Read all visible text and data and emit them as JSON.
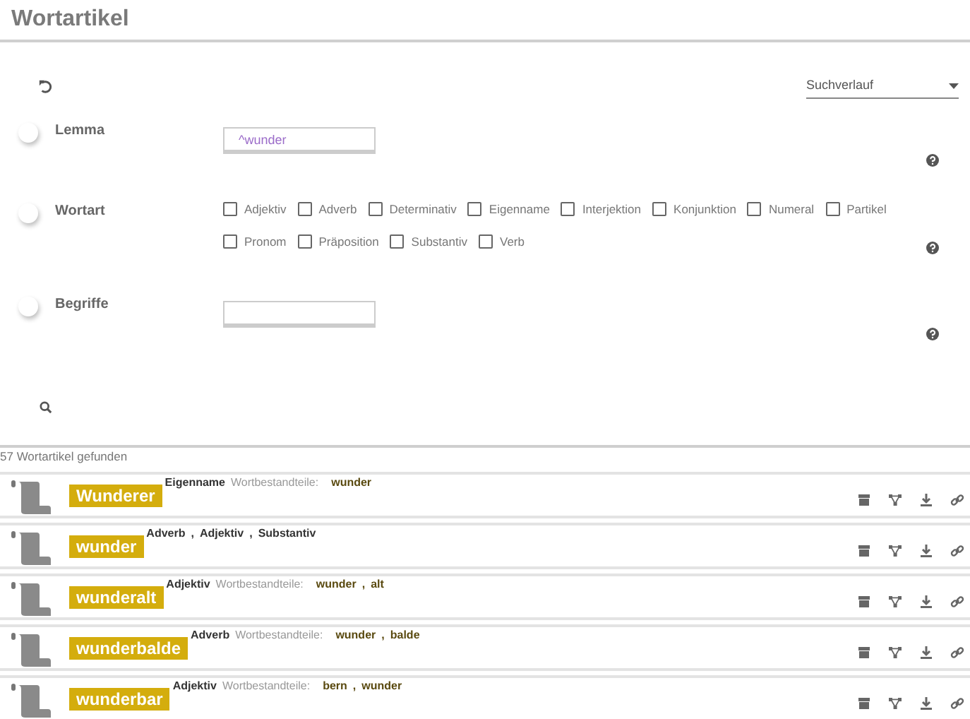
{
  "page": {
    "title": "Wortartikel"
  },
  "history": {
    "placeholder": "Suchverlauf"
  },
  "filters": [
    {
      "kind": "text",
      "label": "Lemma",
      "on": false,
      "value": "^wunder"
    },
    {
      "kind": "checkboxes",
      "label": "Wortart",
      "on": false,
      "options": [
        {
          "label": "Adjektiv",
          "checked": false
        },
        {
          "label": "Adverb",
          "checked": false
        },
        {
          "label": "Determinativ",
          "checked": false
        },
        {
          "label": "Eigenname",
          "checked": false
        },
        {
          "label": "Interjektion",
          "checked": false
        },
        {
          "label": "Konjunktion",
          "checked": false
        },
        {
          "label": "Numeral",
          "checked": false
        },
        {
          "label": "Partikel",
          "checked": false
        },
        {
          "label": "Pronom",
          "checked": false
        },
        {
          "label": "Präposition",
          "checked": false
        },
        {
          "label": "Substantiv",
          "checked": false
        },
        {
          "label": "Verb",
          "checked": false
        }
      ]
    },
    {
      "kind": "text",
      "label": "Begriffe",
      "on": false
    }
  ],
  "result_count": "57 Wortartikel gefunden",
  "results": [
    {
      "lemma": "Wunderer",
      "pos": [
        "Eigenname"
      ],
      "parts_label": "Wortbestandteile:",
      "parts": [
        "wunder"
      ]
    },
    {
      "lemma": "wunder",
      "pos": [
        "Adverb",
        ",",
        "Adjektiv",
        ",",
        "Substantiv"
      ]
    },
    {
      "lemma": "wunderalt",
      "pos": [
        "Adjektiv"
      ],
      "parts_label": "Wortbestandteile:",
      "parts": [
        "wunder",
        ",",
        "alt"
      ]
    },
    {
      "lemma": "wunderbalde",
      "pos": [
        "Adverb"
      ],
      "parts_label": "Wortbestandteile:",
      "parts": [
        "wunder",
        ",",
        "balde"
      ]
    },
    {
      "lemma": "wunderbar",
      "pos": [
        "Adjektiv"
      ],
      "parts_label": "Wortbestandteile:",
      "parts": [
        "bern",
        ",",
        "wunder"
      ]
    }
  ]
}
